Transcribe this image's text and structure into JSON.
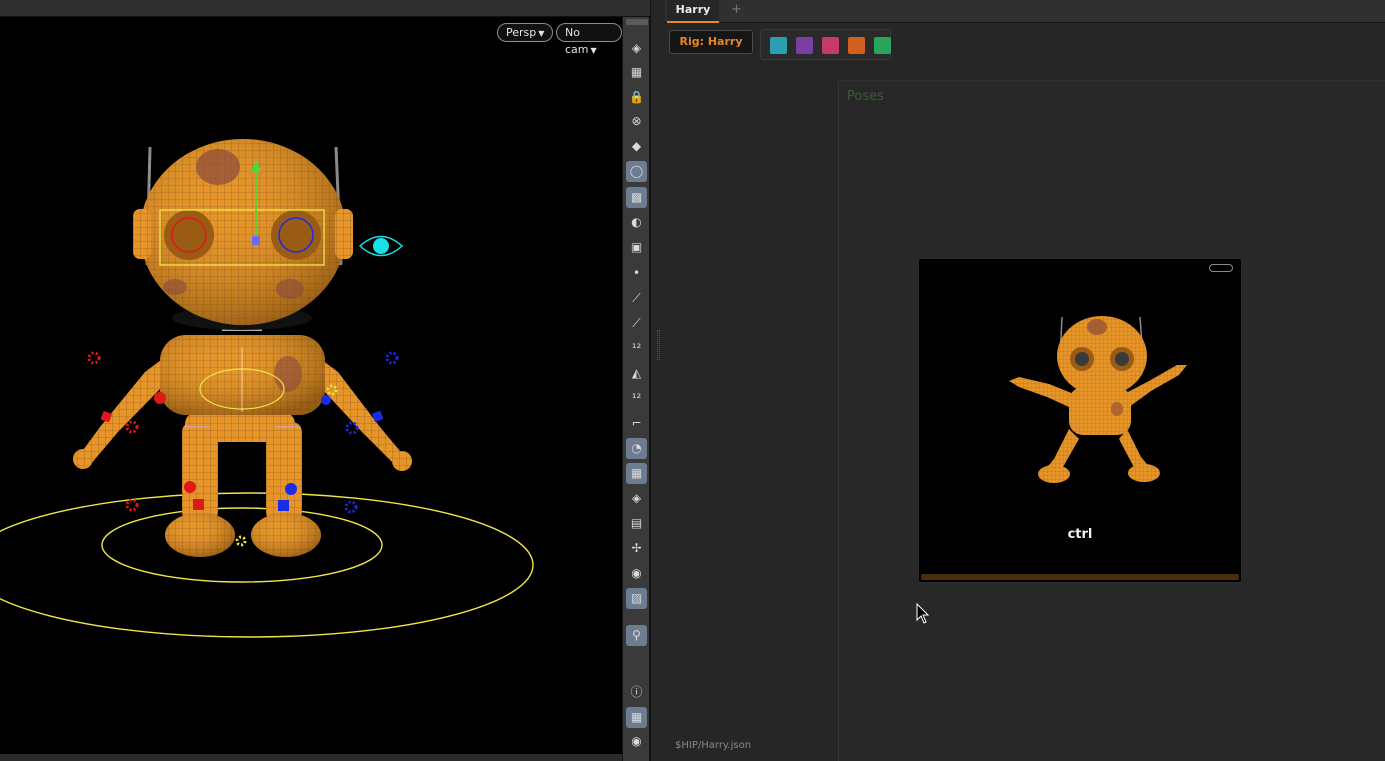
{
  "viewport": {
    "camera_mode": "Persp",
    "camera_select": "No cam"
  },
  "shelf": {
    "tools": [
      {
        "name": "display-options-icon",
        "glyph": "◈",
        "active": false
      },
      {
        "name": "snapshot-icon",
        "glyph": "▦",
        "active": false
      },
      {
        "name": "lock-icon",
        "glyph": "🔒",
        "active": false
      },
      {
        "name": "ghost-icon",
        "glyph": "⊗",
        "active": false
      },
      {
        "name": "light-diamond-icon",
        "glyph": "◆",
        "active": false
      },
      {
        "name": "headlight-icon",
        "glyph": "◯",
        "active": true
      },
      {
        "name": "render-icon",
        "glyph": "▩",
        "active": true
      },
      {
        "name": "visibility-icon",
        "glyph": "◐",
        "active": false
      },
      {
        "name": "camera-icon",
        "glyph": "▣",
        "active": false
      },
      {
        "name": "points-icon",
        "glyph": "•",
        "active": false
      },
      {
        "name": "normals-icon",
        "glyph": "⟋",
        "active": false
      },
      {
        "name": "vertex-normals-icon",
        "glyph": "⟋",
        "active": false
      },
      {
        "name": "point-numbers-icon",
        "glyph": "¹²",
        "active": false
      },
      {
        "name": "prim-normals-icon",
        "glyph": "◭",
        "active": false
      },
      {
        "name": "prim-numbers-icon",
        "glyph": "¹²",
        "active": false
      },
      {
        "name": "edges-icon",
        "glyph": "⌐",
        "active": false
      },
      {
        "name": "shading-icon",
        "glyph": "◔",
        "active": true
      },
      {
        "name": "checker-icon",
        "glyph": "▦",
        "active": true
      },
      {
        "name": "layers-icon",
        "glyph": "◈",
        "active": false
      },
      {
        "name": "map-icon",
        "glyph": "▤",
        "active": false
      },
      {
        "name": "joints-icon",
        "glyph": "✢",
        "active": false
      },
      {
        "name": "stop-icon",
        "glyph": "◉",
        "active": false
      },
      {
        "name": "background-image-icon",
        "glyph": "▨",
        "active": true
      },
      {
        "name": "pin-icon",
        "glyph": "⚲",
        "active": true
      },
      {
        "name": "info-icon",
        "glyph": "ⓘ",
        "active": false
      },
      {
        "name": "grid-layout-icon",
        "glyph": "▦",
        "active": true
      },
      {
        "name": "eye-icon",
        "glyph": "◉",
        "active": false
      }
    ]
  },
  "tabs": {
    "active": "Harry",
    "add": "+"
  },
  "toolbar": {
    "rig_label": "Rig: Harry",
    "swatches": [
      "#2a9fb2",
      "#7a3fa3",
      "#c63a6a",
      "#d2611f",
      "#2aa45a"
    ]
  },
  "poses": {
    "title": "Poses",
    "items": [
      {
        "label": "ctrl"
      }
    ]
  },
  "footer": {
    "path": "$HIP/Harry.json"
  },
  "colors": {
    "accent_orange": "#e08a2c",
    "robot_body": "#e5952a",
    "control_yellow": "#f0e64a",
    "left_controls": "#e01818",
    "right_controls": "#1a2ae8",
    "eye_control": "#19e0e8"
  }
}
